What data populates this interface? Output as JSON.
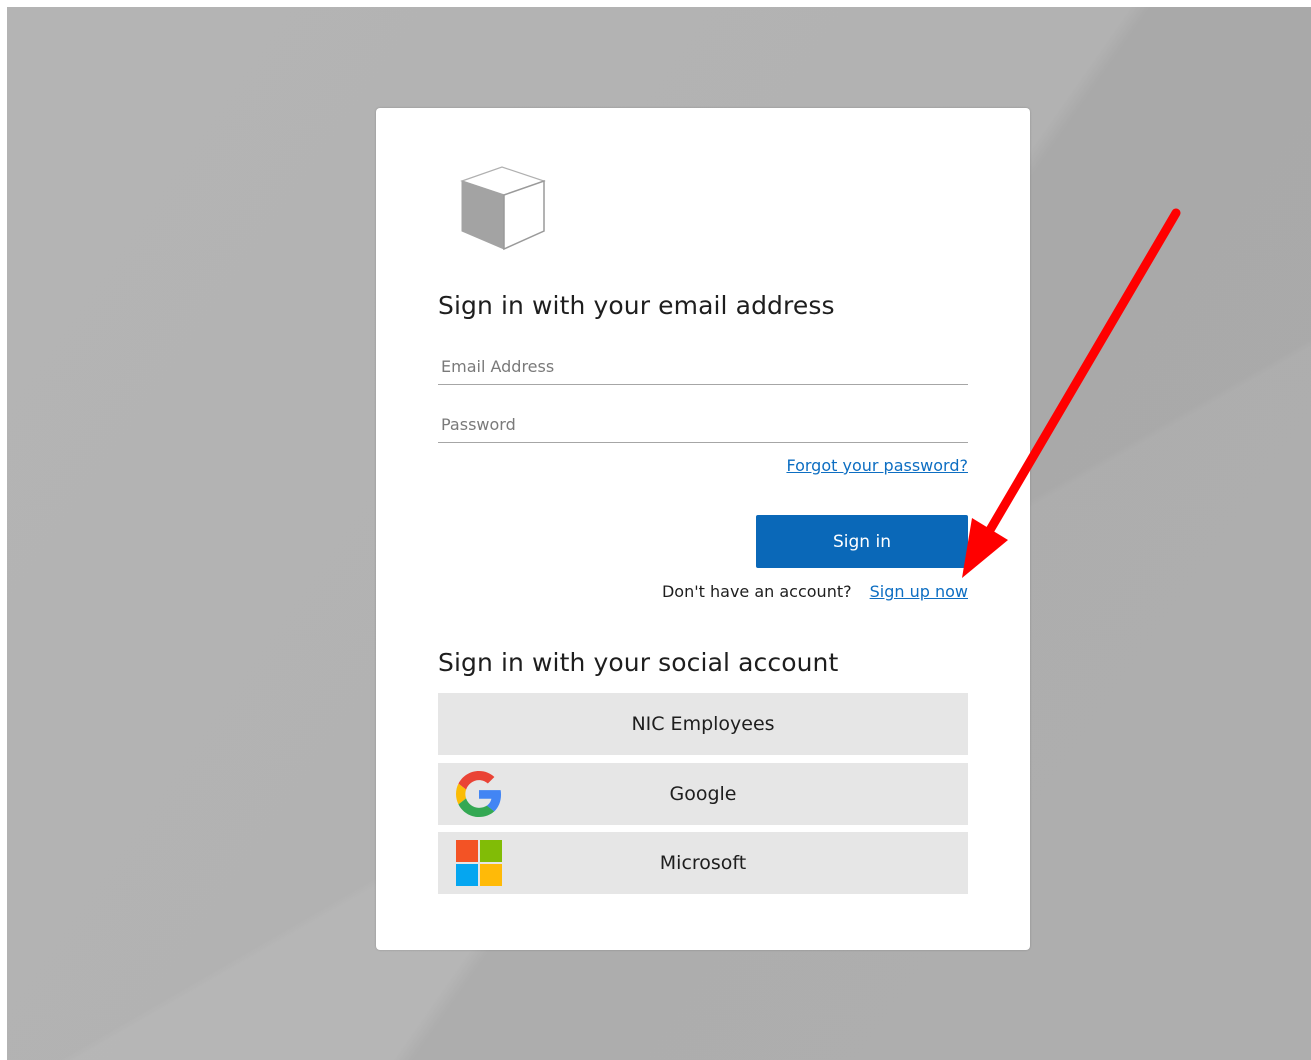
{
  "headings": {
    "email_signin": "Sign in with your email address",
    "social_signin": "Sign in with your social account"
  },
  "fields": {
    "email_placeholder": "Email Address",
    "email_value": "",
    "password_placeholder": "Password",
    "password_value": ""
  },
  "links": {
    "forgot_password": "Forgot your password?",
    "no_account_text": "Don't have an account?",
    "sign_up": "Sign up now"
  },
  "buttons": {
    "sign_in": "Sign in"
  },
  "social_providers": [
    {
      "label": "NIC Employees",
      "icon": "none"
    },
    {
      "label": "Google",
      "icon": "google-icon"
    },
    {
      "label": "Microsoft",
      "icon": "microsoft-icon"
    }
  ],
  "icons": {
    "logo": "cube-logo-icon",
    "annotation": "red-arrow-annotation"
  },
  "colors": {
    "primary": "#0a68b8",
    "link": "#0d6ec2",
    "social_button_bg": "#e6e6e6",
    "background": "#b3b3b3",
    "annotation_arrow": "#ff0000",
    "google_blue": "#4285F4",
    "google_red": "#EA4335",
    "google_yellow": "#FBBC05",
    "google_green": "#34A853",
    "ms_red": "#F35325",
    "ms_green": "#81BC06",
    "ms_blue": "#05A6F0",
    "ms_yellow": "#FFBA08"
  }
}
